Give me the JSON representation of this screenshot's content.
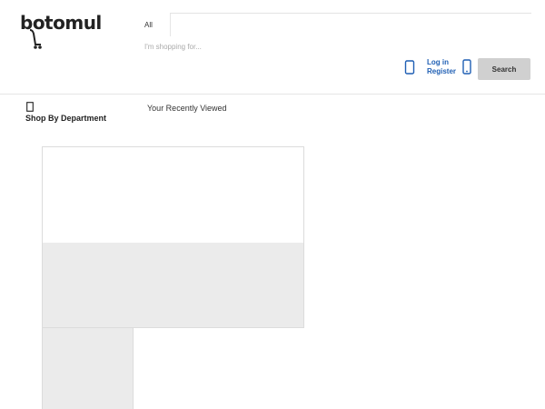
{
  "brand": {
    "logo_text": "botomul"
  },
  "search": {
    "category": "All",
    "placeholder": "I'm shopping for...",
    "value": "",
    "button_label": "Search"
  },
  "account": {
    "login_label": "Log in",
    "register_label": "Register"
  },
  "nav": {
    "department_label": "Shop By Department",
    "recent_label": "Your Recently Viewed"
  },
  "colors": {
    "link": "#1f5fb4",
    "button": "#d0d0d0",
    "panel_fill": "#ebebeb"
  },
  "icons": {
    "cart": "cart-icon",
    "user": "user-icon",
    "phone": "phone-icon",
    "menu": "menu-icon"
  }
}
